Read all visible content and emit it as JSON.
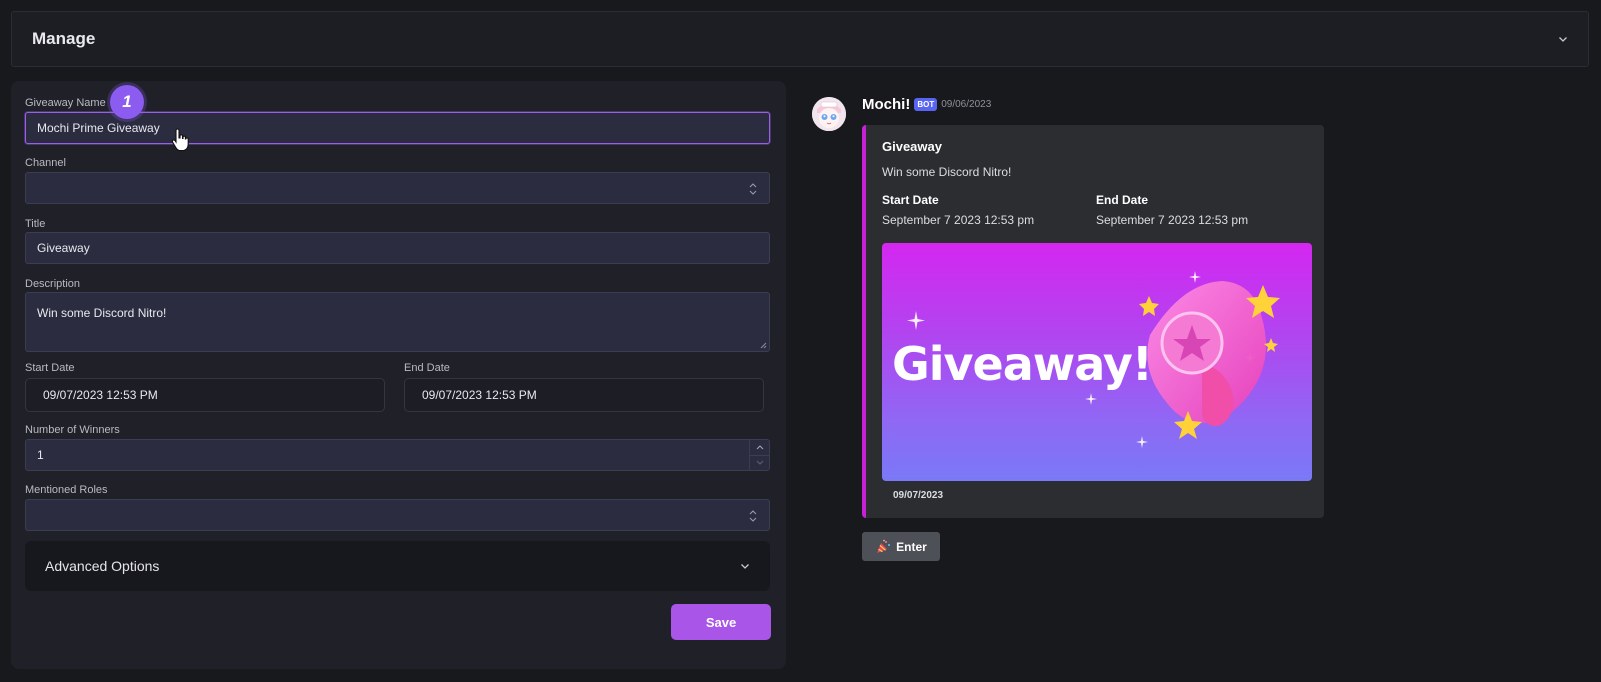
{
  "header": {
    "title": "Manage"
  },
  "form": {
    "step_badge": "1",
    "giveaway_name": {
      "label": "Giveaway Name",
      "value": "Mochi Prime Giveaway"
    },
    "channel": {
      "label": "Channel",
      "value": ""
    },
    "title": {
      "label": "Title",
      "value": "Giveaway"
    },
    "description": {
      "label": "Description",
      "value": "Win some Discord Nitro!"
    },
    "start_date": {
      "label": "Start Date",
      "value": "09/07/2023 12:53 PM"
    },
    "end_date": {
      "label": "End Date",
      "value": "09/07/2023 12:53 PM"
    },
    "winners": {
      "label": "Number of Winners",
      "value": "1"
    },
    "roles": {
      "label": "Mentioned Roles",
      "value": ""
    },
    "advanced_label": "Advanced Options",
    "save_label": "Save"
  },
  "preview": {
    "author": "Mochi!",
    "bot_tag": "BOT",
    "date": "09/06/2023",
    "embed": {
      "accent_color": "#c522d6",
      "title": "Giveaway",
      "description": "Win some Discord Nitro!",
      "fields": [
        {
          "name": "Start Date",
          "value": "September 7 2023 12:53 pm"
        },
        {
          "name": "End Date",
          "value": "September 7 2023 12:53 pm"
        }
      ],
      "image_text": "Giveaway!",
      "footer": "09/07/2023"
    },
    "button_icon": "party-popper-icon",
    "button_label": "Enter"
  },
  "colors": {
    "accent": "#a855e8",
    "bot_tag": "#5865f2"
  }
}
